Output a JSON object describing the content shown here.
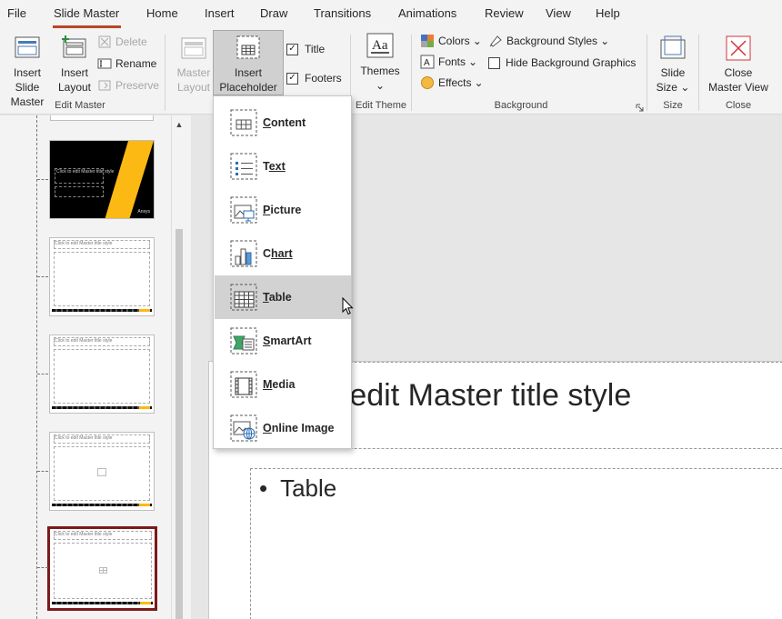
{
  "tabs": [
    {
      "label": "File"
    },
    {
      "label": "Slide Master",
      "active": true
    },
    {
      "label": "Home"
    },
    {
      "label": "Insert"
    },
    {
      "label": "Draw"
    },
    {
      "label": "Transitions"
    },
    {
      "label": "Animations"
    },
    {
      "label": "Review"
    },
    {
      "label": "View"
    },
    {
      "label": "Help"
    }
  ],
  "ribbon": {
    "insert_slide_master": "Insert Slide Master",
    "insert_slide_master_l1": "Insert Slide",
    "insert_slide_master_l2": "Master",
    "insert_layout_l1": "Insert",
    "insert_layout_l2": "Layout",
    "delete": "Delete",
    "rename": "Rename",
    "preserve": "Preserve",
    "master_layout_l1": "Master",
    "master_layout_l2": "Layout",
    "insert_placeholder_l1": "Insert",
    "insert_placeholder_l2": "Placeholder",
    "title_check": "Title",
    "footers_check": "Footers",
    "themes": "Themes",
    "colors": "Colors",
    "fonts": "Fonts",
    "effects": "Effects",
    "background_styles": "Background Styles",
    "hide_background_graphics": "Hide Background Graphics",
    "slide_size_l1": "Slide",
    "slide_size_l2": "Size",
    "close_master_view_l1": "Close",
    "close_master_view_l2": "Master View",
    "groups": {
      "edit_master": "Edit Master",
      "edit_theme": "Edit Theme",
      "background": "Background",
      "size": "Size",
      "close": "Close"
    }
  },
  "thumbnails": {
    "title_text": "Click to edit Master title style",
    "dark_title_text": "Click to edit Master title style",
    "brand_text": "Ansys"
  },
  "slide": {
    "title": "o edit Master title style",
    "bullet": "•",
    "body": "Table"
  },
  "insert_placeholder_menu": {
    "items": [
      {
        "label": "Content",
        "accel": "C",
        "rest": "ontent",
        "icon": "content-placeholder-icon"
      },
      {
        "label": "Text",
        "accel": "T",
        "rest": "ext",
        "icon": "text-placeholder-icon"
      },
      {
        "label": "Picture",
        "accel": "P",
        "rest": "icture",
        "icon": "picture-placeholder-icon"
      },
      {
        "label": "Chart",
        "accel": "C",
        "rest": "hart",
        "icon": "chart-placeholder-icon"
      },
      {
        "label": "Table",
        "accel": "T",
        "rest": "able",
        "icon": "table-placeholder-icon",
        "hovered": true
      },
      {
        "label": "SmartArt",
        "accel": "S",
        "rest": "martArt",
        "icon": "smartart-placeholder-icon"
      },
      {
        "label": "Media",
        "accel": "M",
        "rest": "edia",
        "icon": "media-placeholder-icon"
      },
      {
        "label": "Online Image",
        "accel": "O",
        "rest": "nline Image",
        "icon": "online-image-placeholder-icon"
      }
    ]
  },
  "colors": {
    "accent_red": "#b7472a",
    "selected_thumb_border": "#7b1a1a",
    "brand_yellow": "#fdb913",
    "menu_hover": "#d2d2d2"
  }
}
